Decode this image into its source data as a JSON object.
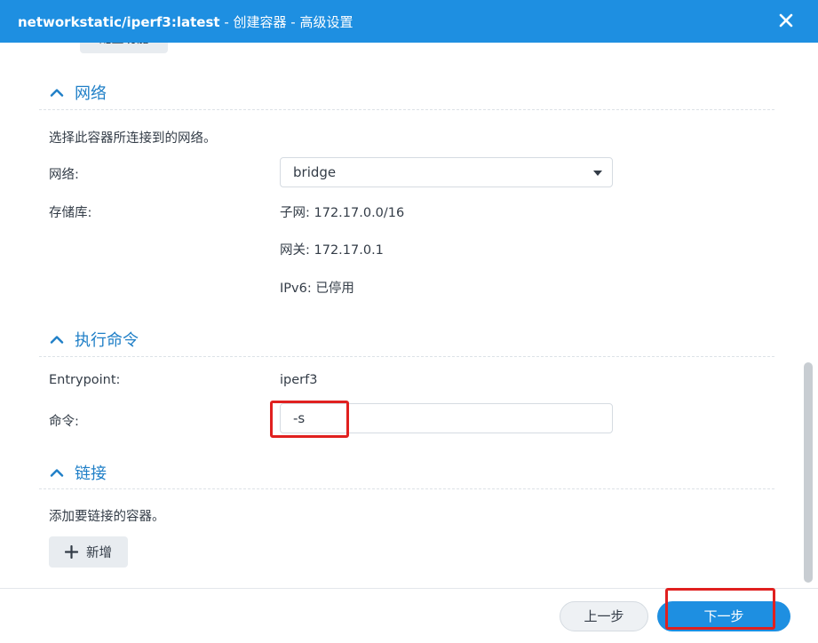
{
  "window": {
    "title_main": "networkstatic/iperf3:latest",
    "title_sub": " - 创建容器 - 高级设置",
    "close_icon": "close-icon"
  },
  "cut_button": {
    "label": "配置功能"
  },
  "network": {
    "heading": "网络",
    "description": "选择此容器所连接到的网络。",
    "network_label": "网络:",
    "network_value": "bridge",
    "storage_label": "存储库:",
    "subnet": "子网: 172.17.0.0/16",
    "gateway": "网关: 172.17.0.1",
    "ipv6": "IPv6: 已停用"
  },
  "command": {
    "heading": "执行命令",
    "entrypoint_label": "Entrypoint:",
    "entrypoint_value": "iperf3",
    "command_label": "命令:",
    "command_value": "-s"
  },
  "links": {
    "heading": "链接",
    "description": "添加要链接的容器。",
    "add_label": "新增"
  },
  "footer": {
    "prev_label": "上一步",
    "next_label": "下一步"
  },
  "colors": {
    "accent": "#1e8fe1",
    "highlight": "#e0201f"
  }
}
